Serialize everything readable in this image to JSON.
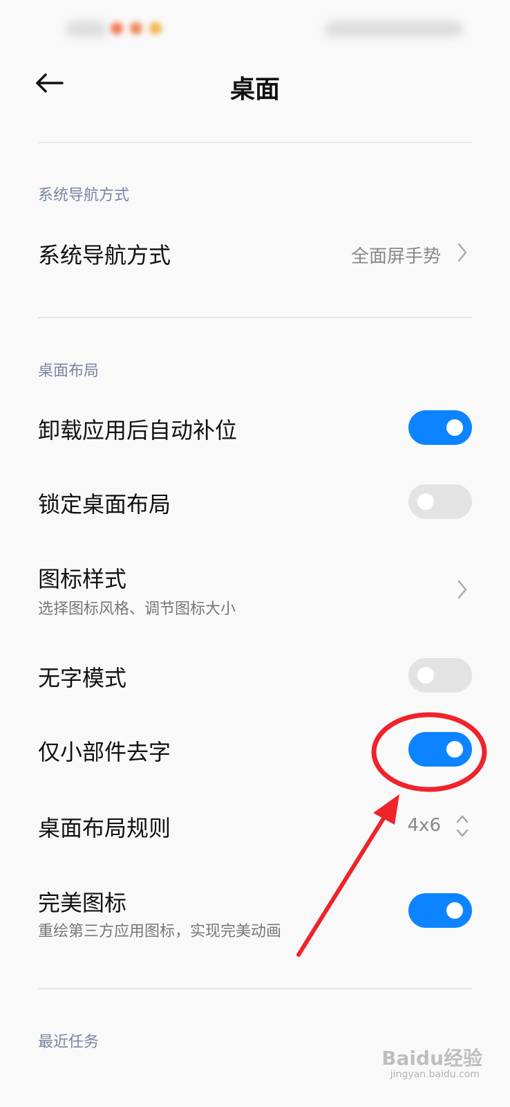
{
  "header": {
    "title": "桌面"
  },
  "sections": [
    {
      "label": "系统导航方式"
    },
    {
      "label": "桌面布局"
    },
    {
      "label": "最近任务"
    }
  ],
  "rows": {
    "nav_mode": {
      "title": "系统导航方式",
      "value": "全面屏手势"
    },
    "auto_fill": {
      "title": "卸载应用后自动补位",
      "toggle": "on"
    },
    "lock_layout": {
      "title": "锁定桌面布局",
      "toggle": "off"
    },
    "icon_style": {
      "title": "图标样式",
      "subtitle": "选择图标风格、调节图标大小"
    },
    "no_text_mode": {
      "title": "无字模式",
      "toggle": "off"
    },
    "widget_no_text": {
      "title": "仅小部件去字",
      "toggle": "on"
    },
    "layout_rule": {
      "title": "桌面布局规则",
      "value": "4x6"
    },
    "perfect_icons": {
      "title": "完美图标",
      "subtitle": "重绘第三方应用图标，实现完美动画",
      "toggle": "on"
    }
  },
  "watermark": {
    "text": "Baidu经验",
    "url_text": "jingyan.baidu.com"
  },
  "colors": {
    "accent": "#0d84ff",
    "annotation": "#f0222a",
    "section_label": "#7a85a3"
  }
}
